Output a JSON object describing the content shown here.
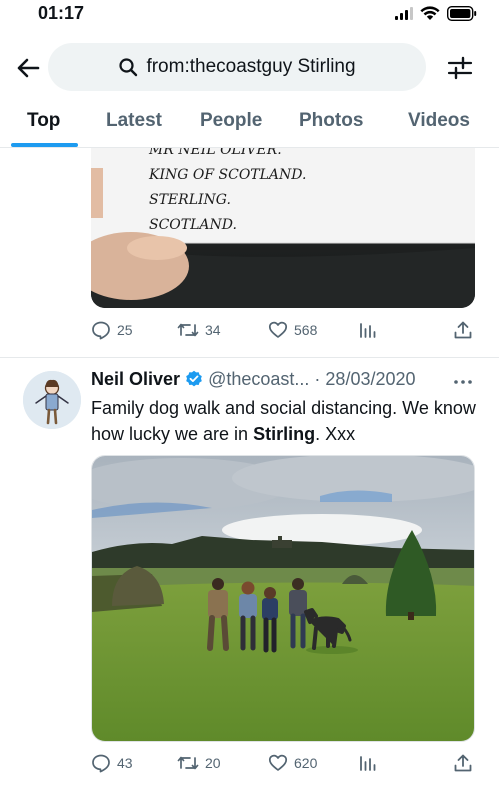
{
  "status_bar": {
    "time": "01:17"
  },
  "search": {
    "query": "from:thecoastguy Stirling"
  },
  "tabs": [
    {
      "label": "Top",
      "active": true
    },
    {
      "label": "Latest",
      "active": false
    },
    {
      "label": "People",
      "active": false
    },
    {
      "label": "Photos",
      "active": false
    },
    {
      "label": "Videos",
      "active": false
    }
  ],
  "tweet1": {
    "envelope_lines": [
      "MR NEIL OLIVER.",
      "KING OF SCOTLAND.",
      "STERLING.",
      "SCOTLAND."
    ],
    "replies": "25",
    "retweets": "34",
    "likes": "568"
  },
  "tweet2": {
    "name": "Neil Oliver",
    "handle": "@thecoast...",
    "date": "· 28/03/2020",
    "text_before": "Family dog walk and social distancing. We know how lucky we are in ",
    "text_bold": "Stirling",
    "text_after": ". Xxx",
    "replies": "43",
    "retweets": "20",
    "likes": "620"
  },
  "colors": {
    "accent": "#1d9bf0",
    "verified": "#1d9bf0",
    "secondary_text": "#536471"
  }
}
